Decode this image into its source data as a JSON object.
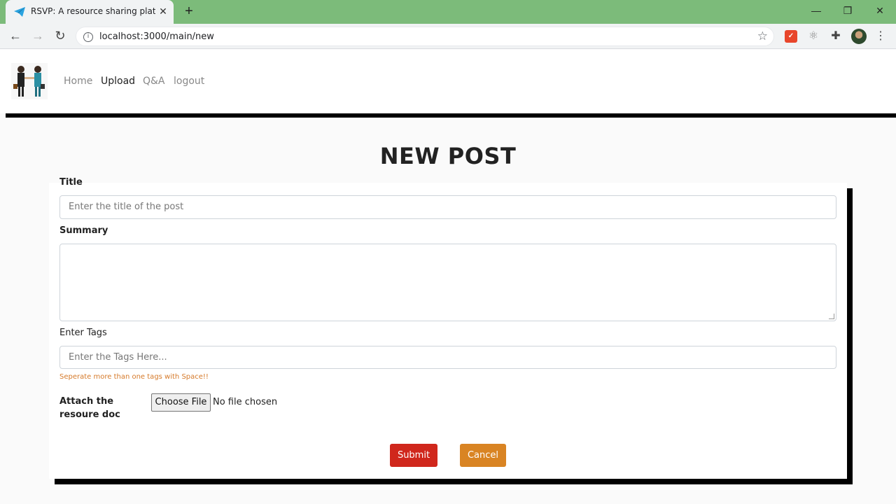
{
  "browser": {
    "tab_title": "RSVP: A resource sharing platform",
    "url": "localhost:3000/main/new",
    "todo_ext_label": "✓"
  },
  "navbar": {
    "links": [
      "Home",
      "Upload",
      "Q&A",
      "logout"
    ],
    "active": "Upload"
  },
  "form": {
    "heading": "NEW POST",
    "title_label": "Title",
    "title_placeholder": "Enter the title of the post",
    "summary_label": "Summary",
    "tags_label": "Enter Tags",
    "tags_placeholder": "Enter the Tags Here...",
    "tags_hint": "Seperate more than one tags with Space!!",
    "attach_label": "Attach the resoure doc",
    "file_button": "Choose File",
    "file_status": "No file chosen",
    "submit_label": "Submit",
    "cancel_label": "Cancel"
  },
  "colors": {
    "tab_strip": "#7cbb7a",
    "submit": "#d0271c",
    "cancel": "#d98423",
    "hint": "#d67a2a"
  }
}
